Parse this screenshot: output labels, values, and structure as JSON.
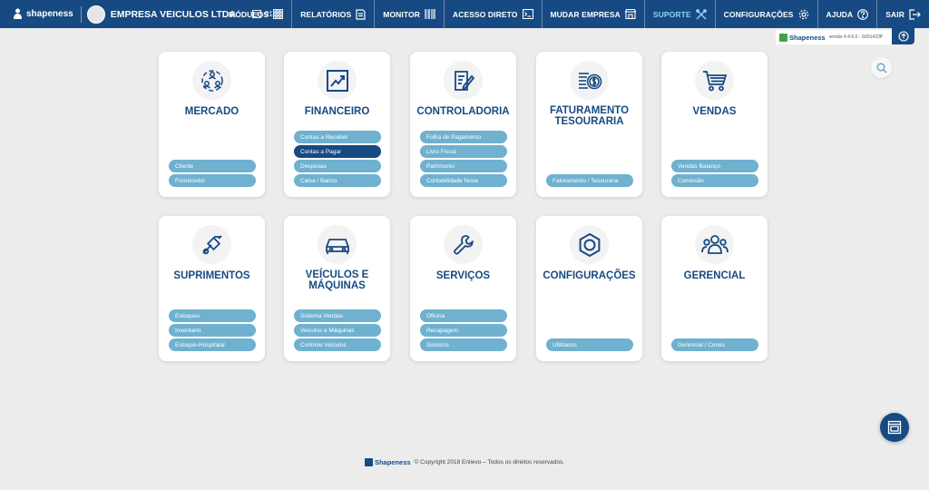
{
  "brand": {
    "name": "shapeness"
  },
  "company": {
    "name": "EMPRESA VEICULOS LTDA"
  },
  "filial": {
    "code": "01"
  },
  "menu": [
    {
      "label": "MÓDULOS",
      "icon": "grid-icon"
    },
    {
      "label": "RELATÓRIOS",
      "icon": "report-icon"
    },
    {
      "label": "MONITOR",
      "icon": "barcode-icon"
    },
    {
      "label": "ACESSO DIRETO",
      "icon": "terminal-icon"
    },
    {
      "label": "MUDAR EMPRESA",
      "icon": "store-icon"
    },
    {
      "label": "SUPORTE",
      "icon": "tools-icon"
    },
    {
      "label": "CONFIGURAÇÕES",
      "icon": "gear-icon"
    },
    {
      "label": "AJUDA",
      "icon": "help-icon"
    },
    {
      "label": "SAIR",
      "icon": "logout-icon"
    }
  ],
  "version": {
    "brand": "Shapeness",
    "text": "versão 4.4.6.0 - S001423P"
  },
  "cards": [
    {
      "title": "MERCADO",
      "icon": "market-users-icon",
      "items": [
        "Cliente",
        "Fornecedor"
      ]
    },
    {
      "title": "FINANCEIRO",
      "icon": "chart-icon",
      "items": [
        "Contas a Receber",
        "Contas a Pagar",
        "Despesas",
        "Caixa / Banco"
      ],
      "active": 1
    },
    {
      "title": "CONTROLADORIA",
      "icon": "document-edit-icon",
      "items": [
        "Folha de Pagamento",
        "Livro Fiscal",
        "Patrimonio",
        "Contabilidade Nova"
      ]
    },
    {
      "title": "FATURAMENTO TESOURARIA",
      "title_l1": "FATURAMENTO",
      "title_l2": "TESOURARIA",
      "icon": "coins-icon",
      "items": [
        "Faturamento / Tesouraria"
      ]
    },
    {
      "title": "VENDAS",
      "icon": "cart-icon",
      "items": [
        "Vendas Balanço",
        "Comissão"
      ]
    },
    {
      "title": "SUPRIMENTOS",
      "icon": "hand-truck-icon",
      "items": [
        "Estoques",
        "Inventario",
        "Estoque-Hospitalar"
      ]
    },
    {
      "title": "VEÍCULOS E MÁQUINAS",
      "title_l1": "VEÍCULOS E",
      "title_l2": "MÁQUINAS",
      "icon": "car-icon",
      "items": [
        "Sistema Vendas",
        "Veiculos e Máquinas",
        "Controle Veiculos"
      ]
    },
    {
      "title": "SERVIÇOS",
      "icon": "wrench-icon",
      "items": [
        "Oficina",
        "Recapagem",
        "Sinistros"
      ]
    },
    {
      "title": "CONFIGURAÇÕES",
      "icon": "hex-nut-icon",
      "items": [
        "Utilitarios"
      ]
    },
    {
      "title": "GERENCIAL",
      "icon": "team-icon",
      "items": [
        "Gerencial / Cones"
      ]
    }
  ],
  "footer": {
    "brand": "Shapeness",
    "copyright": "© Copyright 2018 Enlievo – Todos os direitos reservados."
  },
  "colors": {
    "primary": "#174a82",
    "pill": "#6fb1cf",
    "background": "#ececec"
  }
}
